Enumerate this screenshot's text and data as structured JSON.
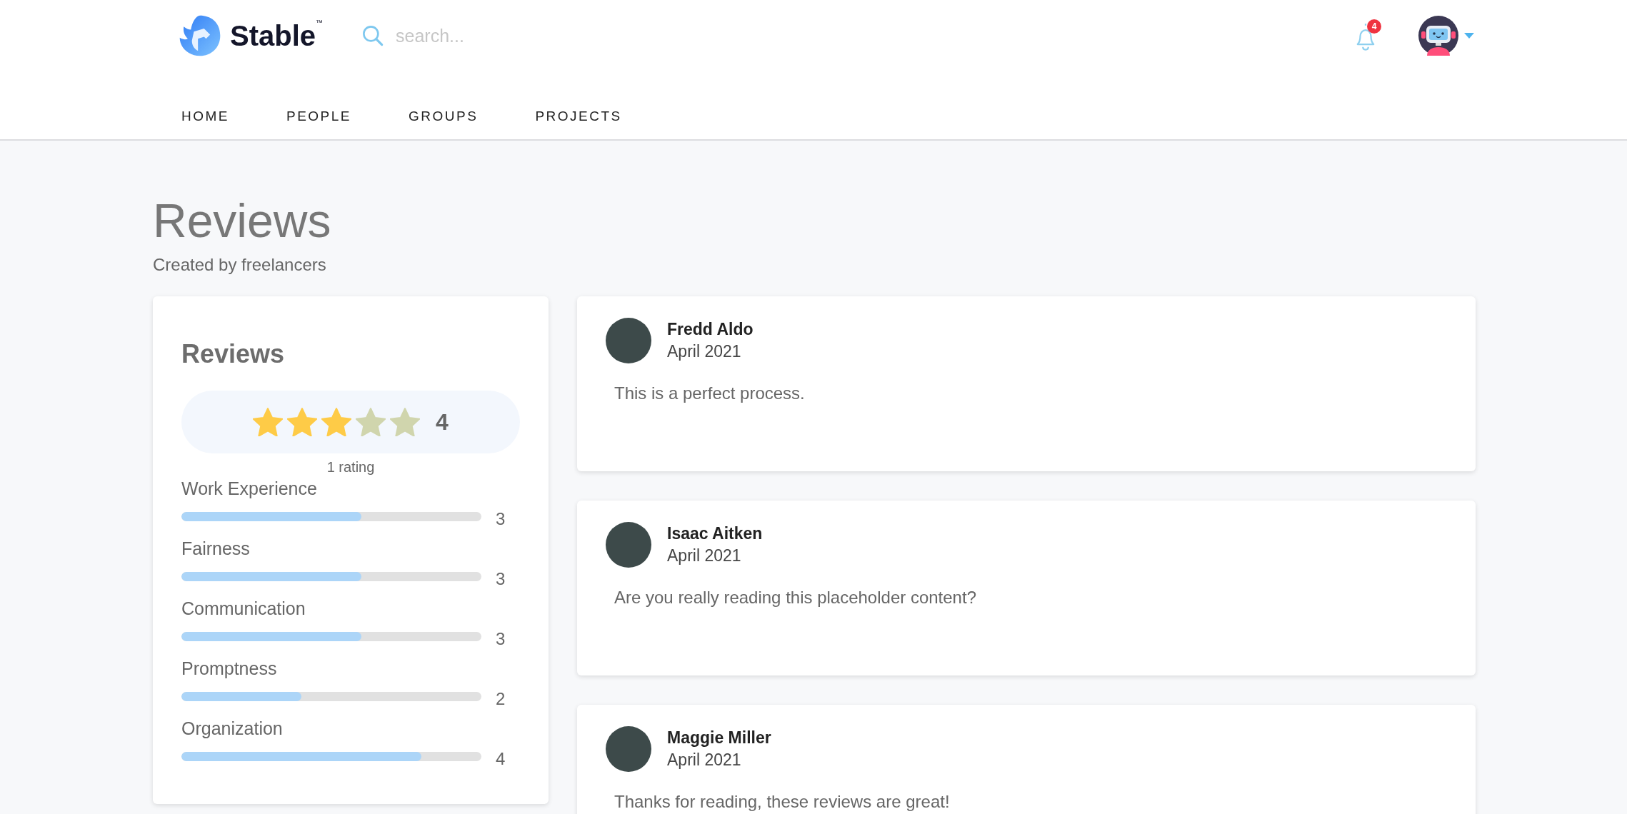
{
  "header": {
    "logo_text": "Stable",
    "logo_mark": "™",
    "search": {
      "placeholder": "search..."
    },
    "notifications": {
      "count": "4"
    }
  },
  "nav": [
    {
      "label": "HOME"
    },
    {
      "label": "PEOPLE"
    },
    {
      "label": "GROUPS"
    },
    {
      "label": "PROJECTS"
    }
  ],
  "page": {
    "title": "Reviews",
    "subtitle": "Created by freelancers"
  },
  "summary": {
    "title": "Reviews",
    "stars": 3,
    "score": "4",
    "rating_count": "1 rating",
    "criteria": [
      {
        "label": "Work Experience",
        "level": 0.6,
        "value": "3"
      },
      {
        "label": "Fairness",
        "level": 0.6,
        "value": "3"
      },
      {
        "label": "Communication",
        "level": 0.6,
        "value": "3"
      },
      {
        "label": "Promptness",
        "level": 0.4,
        "value": "2"
      },
      {
        "label": "Organization",
        "level": 0.8,
        "value": "4"
      }
    ]
  },
  "reviews": [
    {
      "name": "Fredd Aldo",
      "date": "April 2021",
      "text": "This is a perfect process."
    },
    {
      "name": "Isaac Aitken",
      "date": "April 2021",
      "text": "Are you really reading this placeholder content?"
    },
    {
      "name": "Maggie Miller",
      "date": "April 2021",
      "text": "Thanks for reading, these reviews are great!"
    }
  ]
}
